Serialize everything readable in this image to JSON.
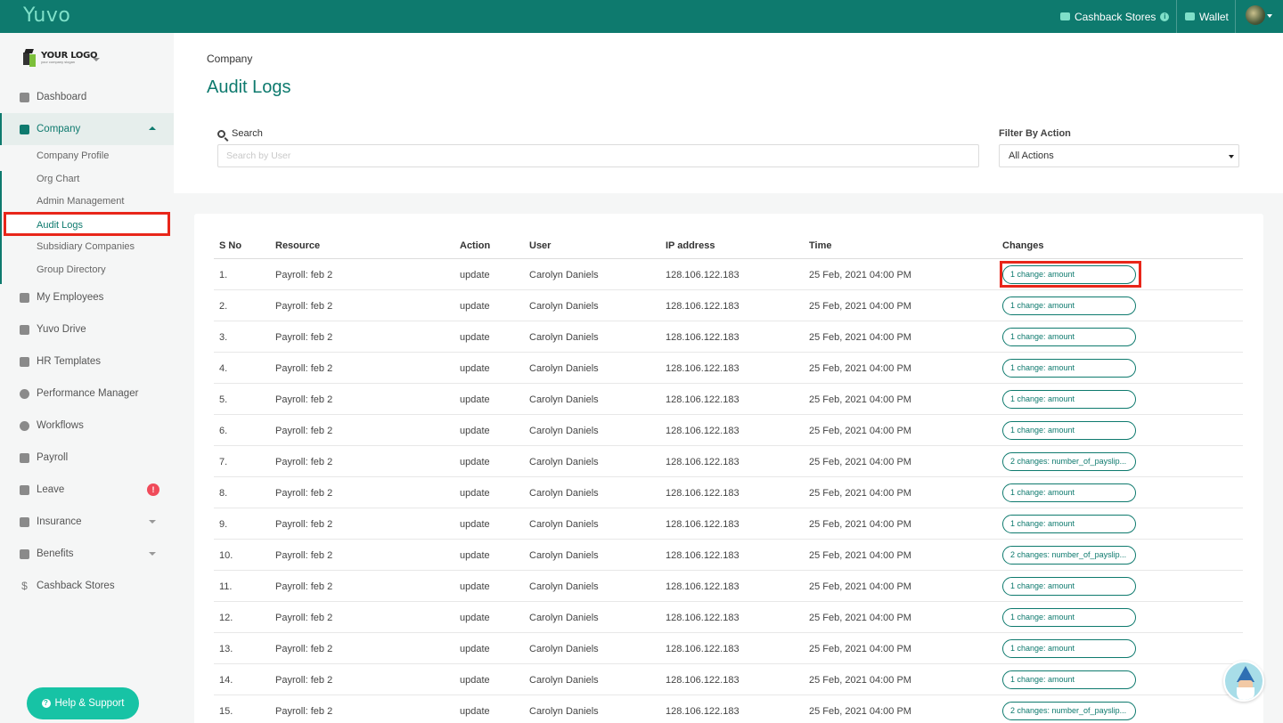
{
  "topbar": {
    "brand": "Yuvo",
    "cashback_label": "Cashback Stores",
    "wallet_label": "Wallet"
  },
  "sidebar": {
    "logo_main": "YOUR LOGO",
    "logo_sub": "your company slogan",
    "items": [
      {
        "label": "Dashboard",
        "icon": "grid-icon"
      },
      {
        "label": "Company",
        "icon": "building-icon"
      },
      {
        "label": "My Employees",
        "icon": "users-icon"
      },
      {
        "label": "Yuvo Drive",
        "icon": "folder-icon"
      },
      {
        "label": "HR Templates",
        "icon": "edit-icon"
      },
      {
        "label": "Performance Manager",
        "icon": "target-icon"
      },
      {
        "label": "Workflows",
        "icon": "cogs-icon"
      },
      {
        "label": "Payroll",
        "icon": "payroll-icon"
      },
      {
        "label": "Leave",
        "icon": "calendar-icon",
        "badge": "!"
      },
      {
        "label": "Insurance",
        "icon": "insurance-icon"
      },
      {
        "label": "Benefits",
        "icon": "briefcase-icon"
      },
      {
        "label": "Cashback Stores",
        "icon": "dollar-icon"
      }
    ],
    "company_sub": [
      "Company Profile",
      "Org Chart",
      "Admin Management",
      "Audit Logs",
      "Subsidiary Companies",
      "Group Directory"
    ],
    "help_label": "Help & Support"
  },
  "main": {
    "breadcrumb": "Company",
    "title": "Audit Logs",
    "search_label": "Search",
    "search_placeholder": "Search by User",
    "filter_label": "Filter By Action",
    "filter_value": "All Actions"
  },
  "table": {
    "headers": [
      "S No",
      "Resource",
      "Action",
      "User",
      "IP address",
      "Time",
      "Changes"
    ],
    "rows": [
      [
        "1.",
        "Payroll: feb 2",
        "update",
        "Carolyn Daniels",
        "128.106.122.183",
        "25 Feb, 2021 04:00 PM",
        "1 change: amount"
      ],
      [
        "2.",
        "Payroll: feb 2",
        "update",
        "Carolyn Daniels",
        "128.106.122.183",
        "25 Feb, 2021 04:00 PM",
        "1 change: amount"
      ],
      [
        "3.",
        "Payroll: feb 2",
        "update",
        "Carolyn Daniels",
        "128.106.122.183",
        "25 Feb, 2021 04:00 PM",
        "1 change: amount"
      ],
      [
        "4.",
        "Payroll: feb 2",
        "update",
        "Carolyn Daniels",
        "128.106.122.183",
        "25 Feb, 2021 04:00 PM",
        "1 change: amount"
      ],
      [
        "5.",
        "Payroll: feb 2",
        "update",
        "Carolyn Daniels",
        "128.106.122.183",
        "25 Feb, 2021 04:00 PM",
        "1 change: amount"
      ],
      [
        "6.",
        "Payroll: feb 2",
        "update",
        "Carolyn Daniels",
        "128.106.122.183",
        "25 Feb, 2021 04:00 PM",
        "1 change: amount"
      ],
      [
        "7.",
        "Payroll: feb 2",
        "update",
        "Carolyn Daniels",
        "128.106.122.183",
        "25 Feb, 2021 04:00 PM",
        "2 changes: number_of_payslip..."
      ],
      [
        "8.",
        "Payroll: feb 2",
        "update",
        "Carolyn Daniels",
        "128.106.122.183",
        "25 Feb, 2021 04:00 PM",
        "1 change: amount"
      ],
      [
        "9.",
        "Payroll: feb 2",
        "update",
        "Carolyn Daniels",
        "128.106.122.183",
        "25 Feb, 2021 04:00 PM",
        "1 change: amount"
      ],
      [
        "10.",
        "Payroll: feb 2",
        "update",
        "Carolyn Daniels",
        "128.106.122.183",
        "25 Feb, 2021 04:00 PM",
        "2 changes: number_of_payslip..."
      ],
      [
        "11.",
        "Payroll: feb 2",
        "update",
        "Carolyn Daniels",
        "128.106.122.183",
        "25 Feb, 2021 04:00 PM",
        "1 change: amount"
      ],
      [
        "12.",
        "Payroll: feb 2",
        "update",
        "Carolyn Daniels",
        "128.106.122.183",
        "25 Feb, 2021 04:00 PM",
        "1 change: amount"
      ],
      [
        "13.",
        "Payroll: feb 2",
        "update",
        "Carolyn Daniels",
        "128.106.122.183",
        "25 Feb, 2021 04:00 PM",
        "1 change: amount"
      ],
      [
        "14.",
        "Payroll: feb 2",
        "update",
        "Carolyn Daniels",
        "128.106.122.183",
        "25 Feb, 2021 04:00 PM",
        "1 change: amount"
      ],
      [
        "15.",
        "Payroll: feb 2",
        "update",
        "Carolyn Daniels",
        "128.106.122.183",
        "25 Feb, 2021 04:00 PM",
        "2 changes: number_of_payslip..."
      ]
    ]
  },
  "colors": {
    "brand": "#0e7a6e",
    "accent": "#17c3a5",
    "highlight": "#e8261a",
    "badge": "#f04b5a"
  }
}
